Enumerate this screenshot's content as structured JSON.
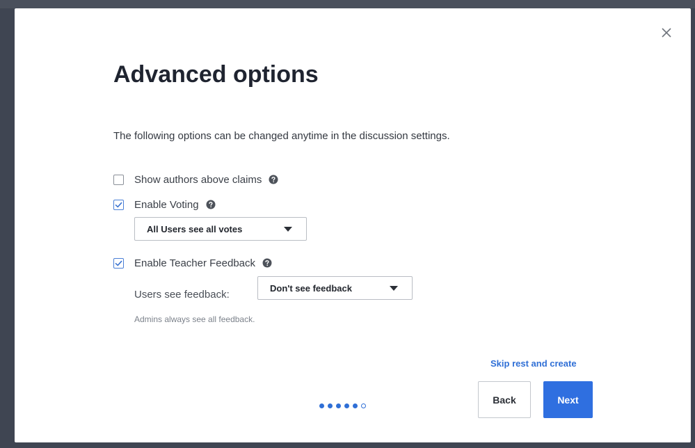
{
  "modal": {
    "title": "Advanced options",
    "description": "The following options can be changed anytime in the discussion settings."
  },
  "options": {
    "show_authors": {
      "label": "Show authors above claims",
      "checked": false
    },
    "enable_voting": {
      "label": "Enable Voting",
      "checked": true,
      "select_value": "All Users see all votes"
    },
    "teacher_feedback": {
      "label": "Enable Teacher Feedback",
      "checked": true,
      "users_label": "Users see feedback:",
      "select_value": "Don't see feedback",
      "hint": "Admins always see all feedback."
    }
  },
  "footer": {
    "skip_label": "Skip rest and create",
    "back_label": "Back",
    "next_label": "Next",
    "steps_total": 6,
    "current_step": 6
  },
  "icons": {
    "close": "close-icon",
    "help": "help-icon",
    "check": "check-icon",
    "dropdown": "caret-down-icon"
  },
  "colors": {
    "accent": "#2f6fe0",
    "link": "#2f6fd6",
    "title": "#1f2430"
  }
}
